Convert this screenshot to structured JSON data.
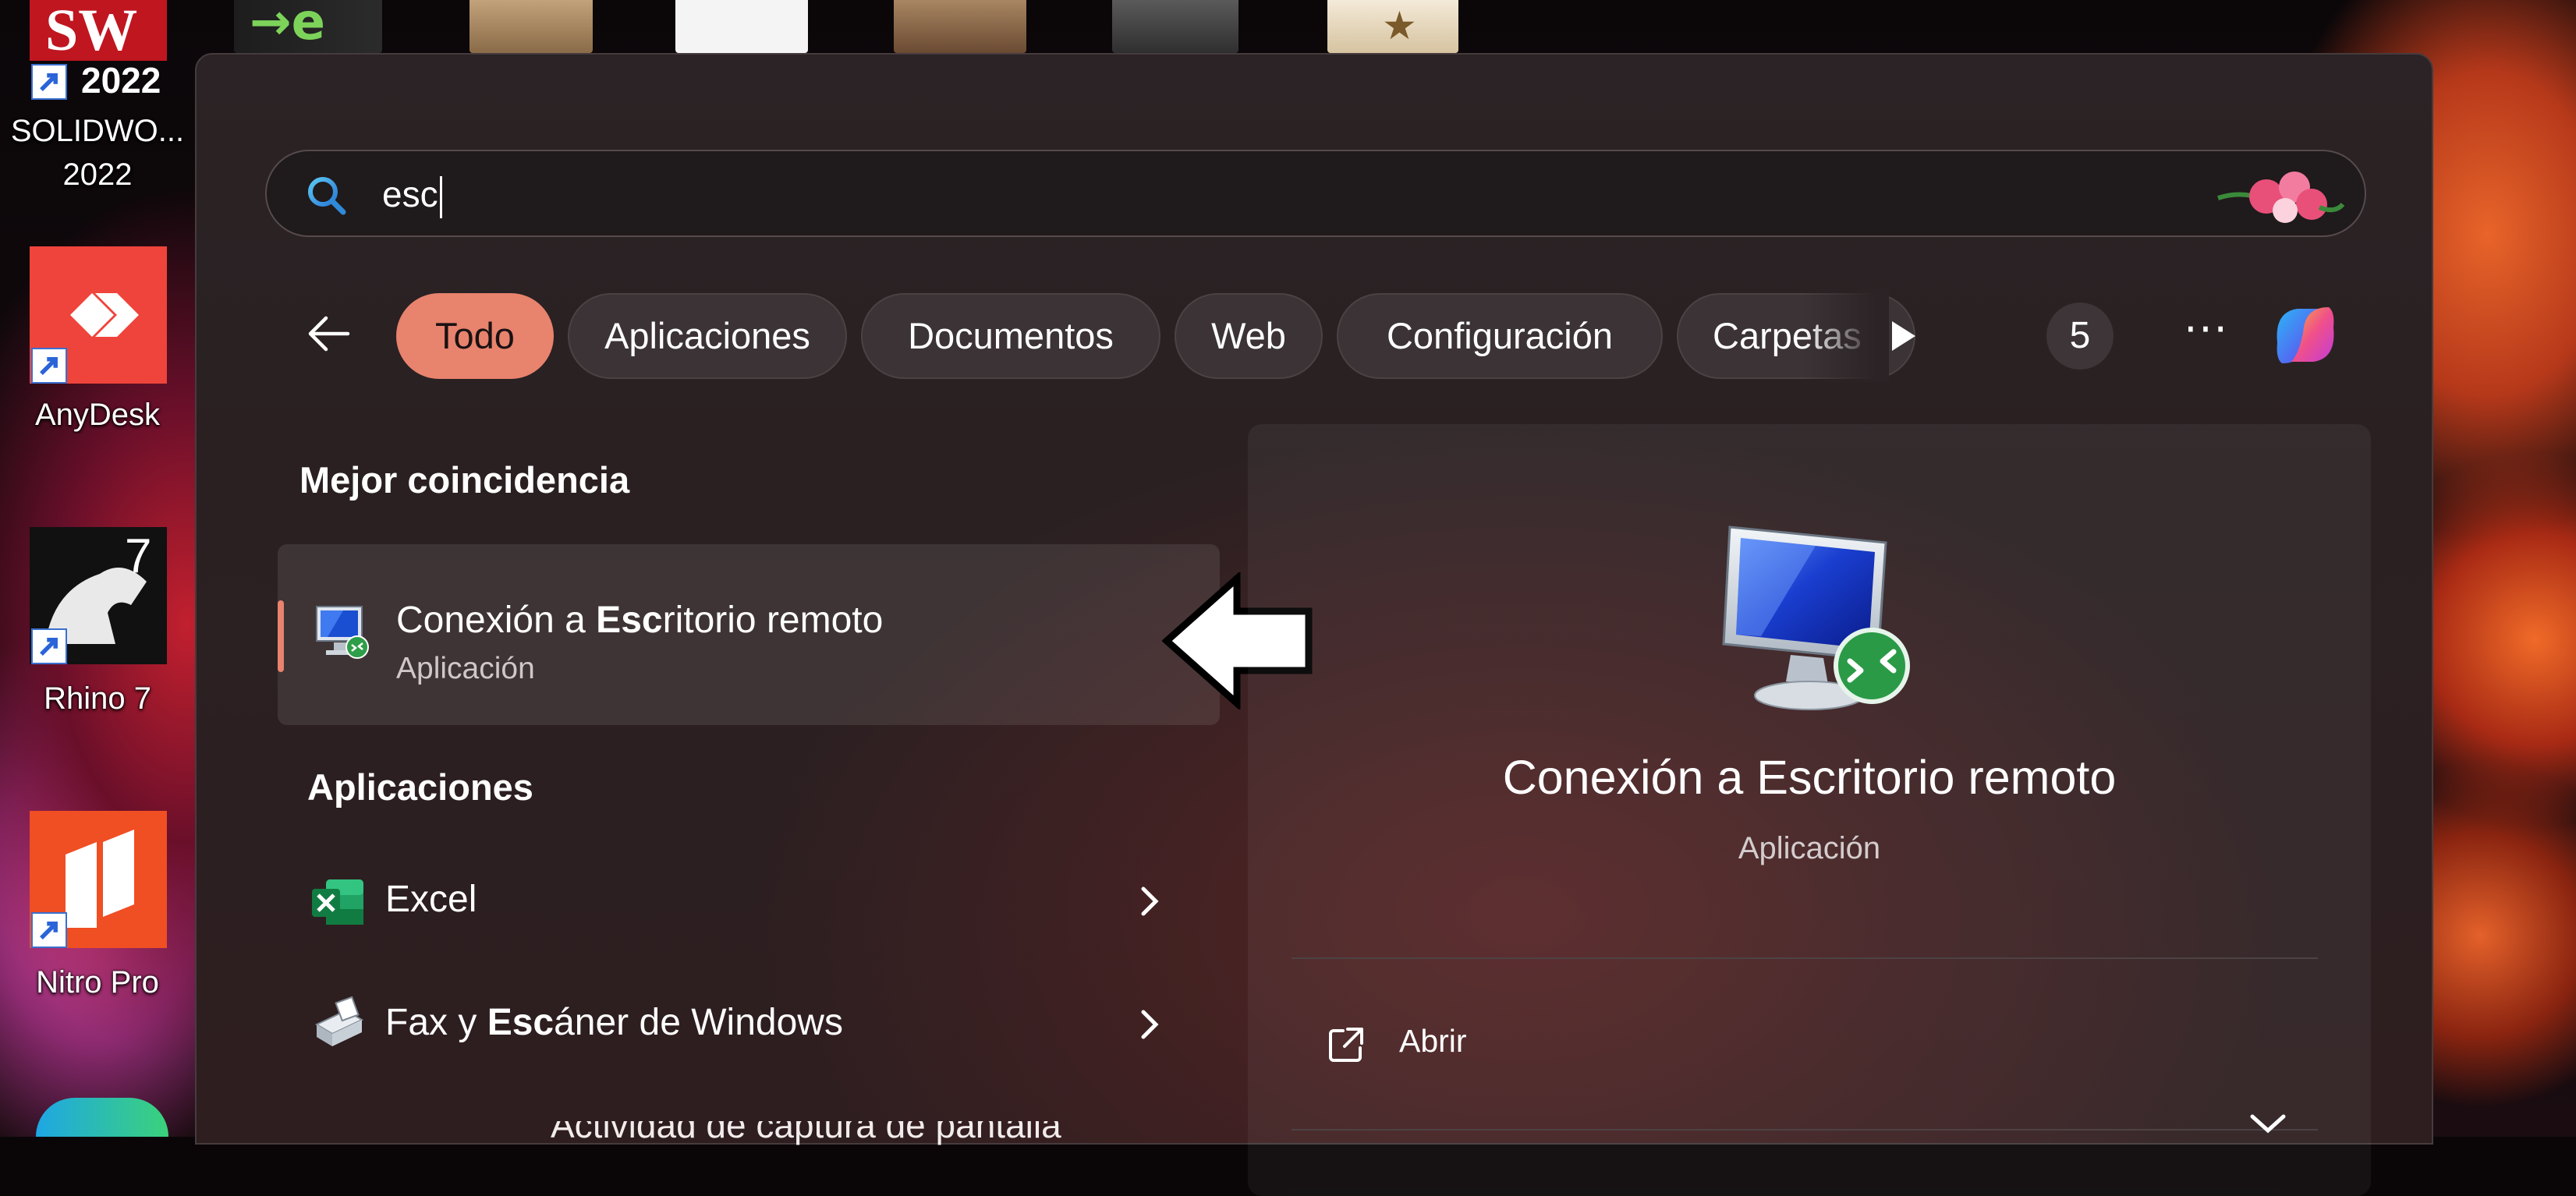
{
  "desktop": {
    "icons": [
      {
        "label_line1": "SOLIDWO...",
        "label_line2": "2022",
        "tile_text": "SW",
        "tile_year": "2022"
      },
      {
        "label_line1": "AnyDesk"
      },
      {
        "label_line1": "Rhino 7",
        "tile_text": "7"
      },
      {
        "label_line1": "Nitro Pro"
      }
    ]
  },
  "search": {
    "query": "esc"
  },
  "filters": {
    "items": [
      "Todo",
      "Aplicaciones",
      "Documentos",
      "Web",
      "Configuración",
      "Carpetas"
    ],
    "active": "Todo",
    "count": "5",
    "more_label": "···"
  },
  "results": {
    "best_match_heading": "Mejor coincidencia",
    "best_match": {
      "title_pre": "Conexión a ",
      "title_bold": "Esc",
      "title_post": "ritorio remoto",
      "subtitle": "Aplicación"
    },
    "apps_heading": "Aplicaciones",
    "apps": [
      {
        "title_pre": "",
        "title_bold": "",
        "title_post": "Excel"
      },
      {
        "title_pre": "Fax y ",
        "title_bold": "Esc",
        "title_post": "áner de Windows"
      }
    ],
    "partial_row_text": "Actividad de captura de pantalla"
  },
  "detail": {
    "title": "Conexión a Escritorio remoto",
    "subtitle": "Aplicación",
    "actions": [
      {
        "label": "Abrir"
      }
    ]
  },
  "colors": {
    "accent": "#e8836e",
    "panel_bg": "#2b2325",
    "chip_bg": "#3b3335"
  }
}
